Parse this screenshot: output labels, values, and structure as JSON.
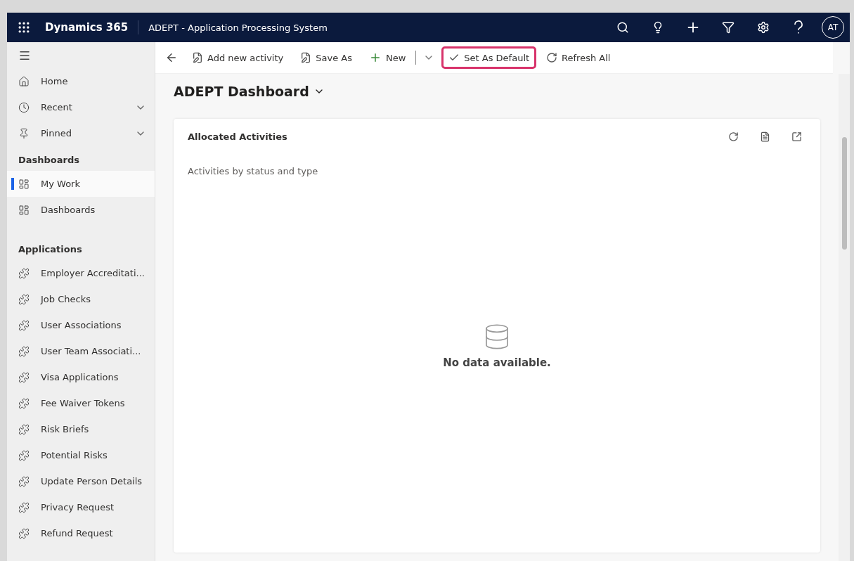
{
  "header": {
    "app_name": "Dynamics 365",
    "title": "ADEPT - Application Processing System",
    "avatar": "AT"
  },
  "command_bar": [
    {
      "kind": "back"
    },
    {
      "kind": "save",
      "label": "Add new activity",
      "highlighted": false
    },
    {
      "kind": "save",
      "label": "Save As",
      "highlighted": false
    },
    {
      "kind": "new",
      "label": "New",
      "highlighted": false
    },
    {
      "kind": "check",
      "label": "Set As Default",
      "highlighted": true
    },
    {
      "kind": "refresh",
      "label": "Refresh All",
      "highlighted": false
    }
  ],
  "sidebar": {
    "items": [
      {
        "kind": "home",
        "label": "Home",
        "selected": false
      },
      {
        "kind": "recent",
        "label": "Recent",
        "selected": false
      },
      {
        "kind": "pinned",
        "label": "Pinned",
        "selected": false
      }
    ],
    "sections": [
      {
        "title": "Dashboards",
        "items": [
          {
            "label": "My Work",
            "selected": true
          },
          {
            "label": "Dashboards",
            "selected": false
          }
        ]
      },
      {
        "title": "Applications",
        "items": [
          {
            "label": "Employer Accreditati...",
            "selected": false
          },
          {
            "label": "Job Checks",
            "selected": false
          },
          {
            "label": "User Associations",
            "selected": false
          },
          {
            "label": "User Team Associati...",
            "selected": false
          },
          {
            "label": "Visa Applications",
            "selected": false
          },
          {
            "label": "Fee Waiver Tokens",
            "selected": false
          },
          {
            "label": "Risk Briefs",
            "selected": false
          },
          {
            "label": "Potential Risks",
            "selected": false
          },
          {
            "label": "Update Person Details",
            "selected": false
          },
          {
            "label": "Privacy Request",
            "selected": false
          },
          {
            "label": "Refund Request",
            "selected": false
          }
        ]
      }
    ]
  },
  "dashboard": {
    "title": "ADEPT Dashboard",
    "card": {
      "title": "Allocated Activities",
      "subtitle": "Activities by status and type",
      "empty_message": "No data available."
    }
  }
}
